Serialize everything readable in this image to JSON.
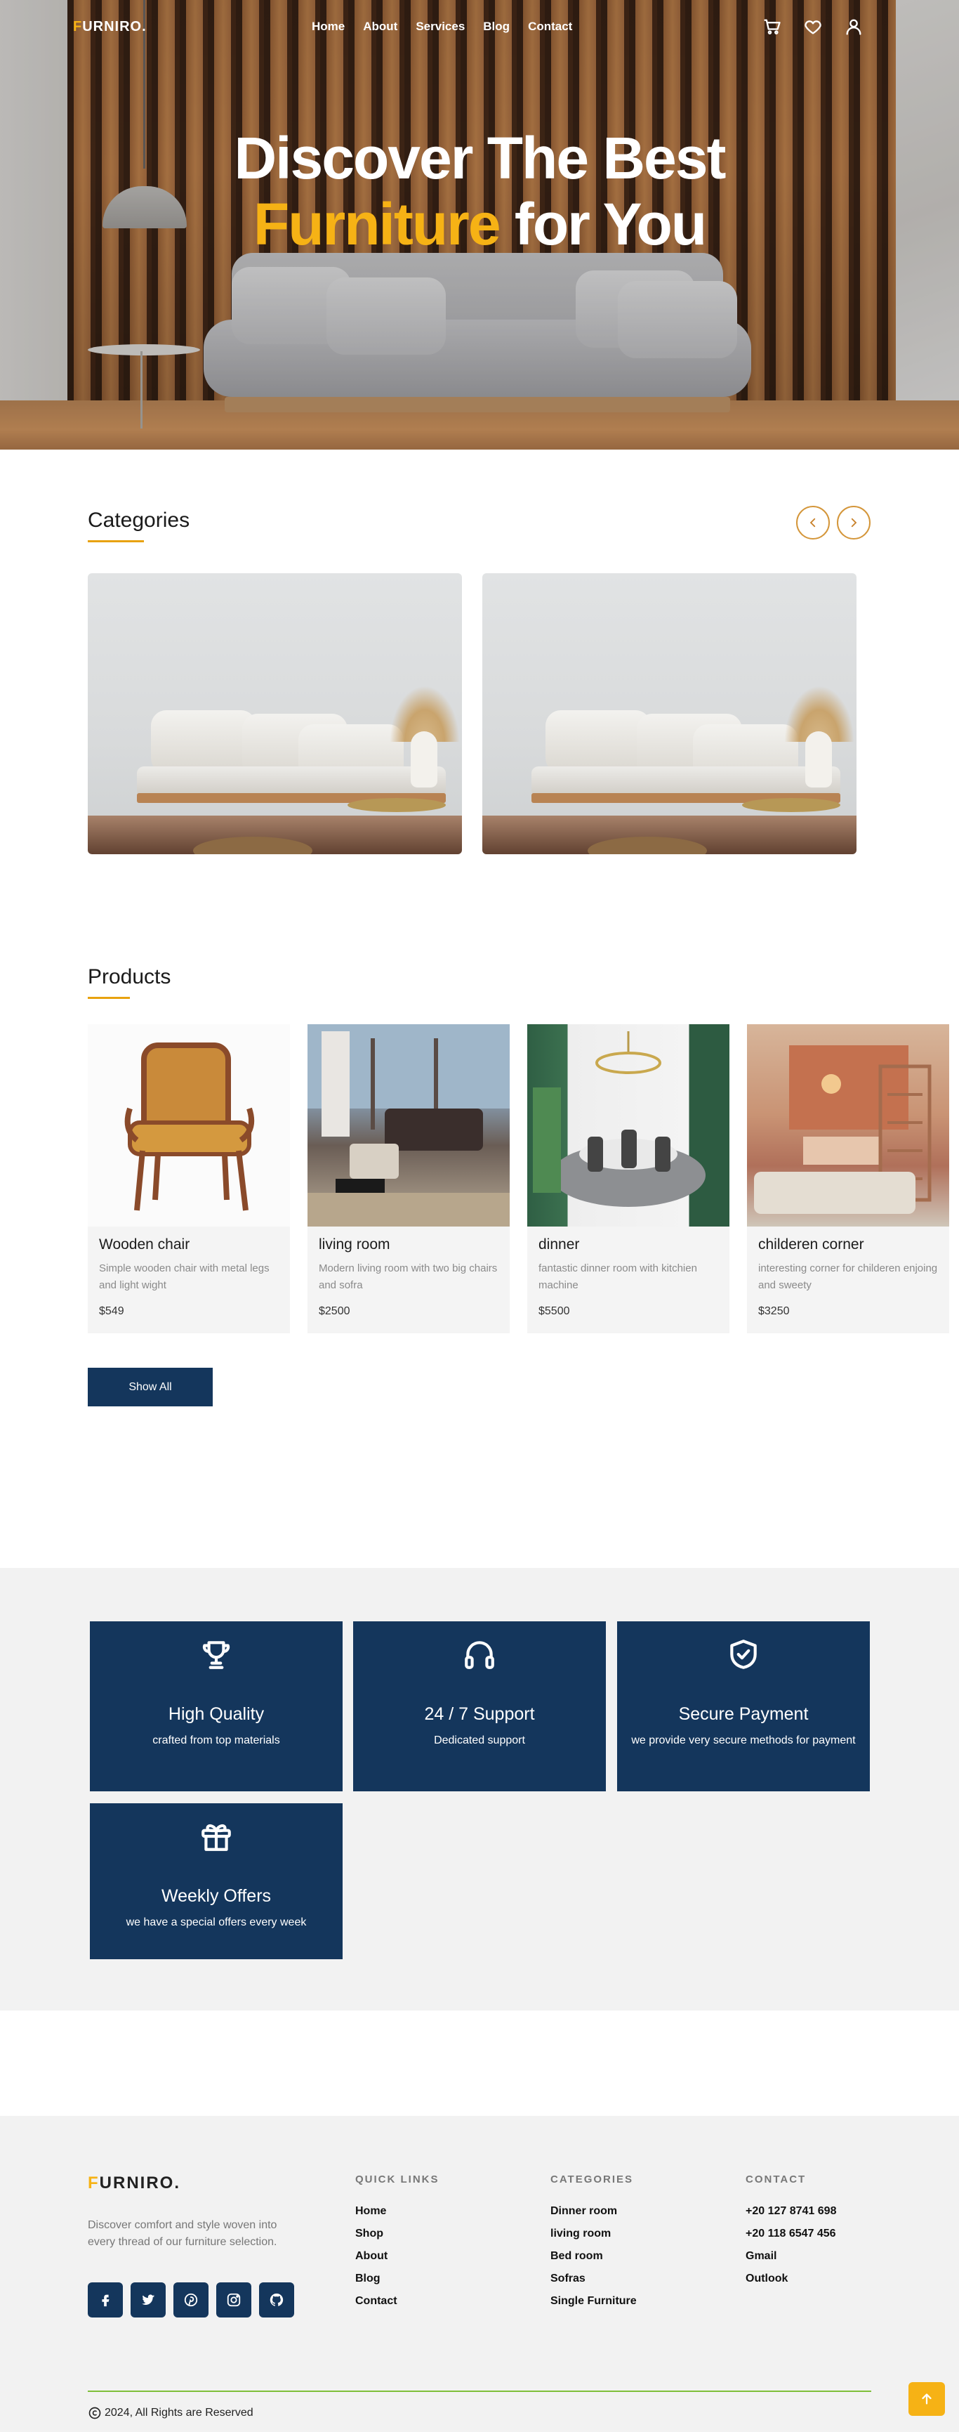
{
  "nav": {
    "logo_initial": "F",
    "logo_rest": "URNIRO.",
    "links": [
      "Home",
      "About",
      "Services",
      "Blog",
      "Contact"
    ],
    "icons": [
      "cart-icon",
      "heart-icon",
      "user-icon"
    ]
  },
  "hero": {
    "line1": "Discover The Best",
    "line2_accent": "Furniture",
    "line2_rest": " for You",
    "accent_color": "#f6b215"
  },
  "categories": {
    "title": "Categories",
    "prev_icon": "chevron-left-icon",
    "next_icon": "chevron-right-icon"
  },
  "products": {
    "title": "Products",
    "items": [
      {
        "name": "Wooden chair",
        "desc": "Simple wooden chair with metal legs and light wight",
        "price": "$549"
      },
      {
        "name": "living room",
        "desc": "Modern living room with two big chairs and sofra",
        "price": "$2500"
      },
      {
        "name": "dinner",
        "desc": "fantastic dinner room with kitchien machine",
        "price": "$5500"
      },
      {
        "name": "childeren corner",
        "desc": "interesting corner for childeren enjoing and sweety",
        "price": "$3250"
      }
    ],
    "show_all": "Show All"
  },
  "features": [
    {
      "icon": "trophy-icon",
      "title": "High Quality",
      "subtitle": "crafted from top materials"
    },
    {
      "icon": "headphones-icon",
      "title": "24 / 7 Support",
      "subtitle": "Dedicated support"
    },
    {
      "icon": "shield-check-icon",
      "title": "Secure Payment",
      "subtitle": "we provide very secure methods for payment"
    },
    {
      "icon": "gift-icon",
      "title": "Weekly Offers",
      "subtitle": "we have a special offers every week"
    }
  ],
  "footer": {
    "logo_initial": "F",
    "logo_rest": "URNIRO.",
    "description": "Discover comfort and style woven into every thread of our furniture selection.",
    "socials": [
      "facebook-icon",
      "twitter-icon",
      "pinterest-icon",
      "instagram-icon",
      "github-icon"
    ],
    "quick_links": {
      "title": "QUICK LINKS",
      "items": [
        "Home",
        "Shop",
        "About",
        "Blog",
        "Contact"
      ]
    },
    "categories": {
      "title": "CATEGORIES",
      "items": [
        "Dinner room",
        "living room",
        "Bed room",
        "Sofras",
        "Single Furniture"
      ]
    },
    "contact": {
      "title": "CONTACT",
      "items": [
        "+20 127 8741 698",
        "+20 118 6547 456",
        "Gmail",
        "Outlook"
      ]
    },
    "copyright": "2024, All Rights are Reserved"
  },
  "colors": {
    "primary": "#14365c",
    "accent": "#f6b215",
    "divider": "#7fbf3a"
  }
}
